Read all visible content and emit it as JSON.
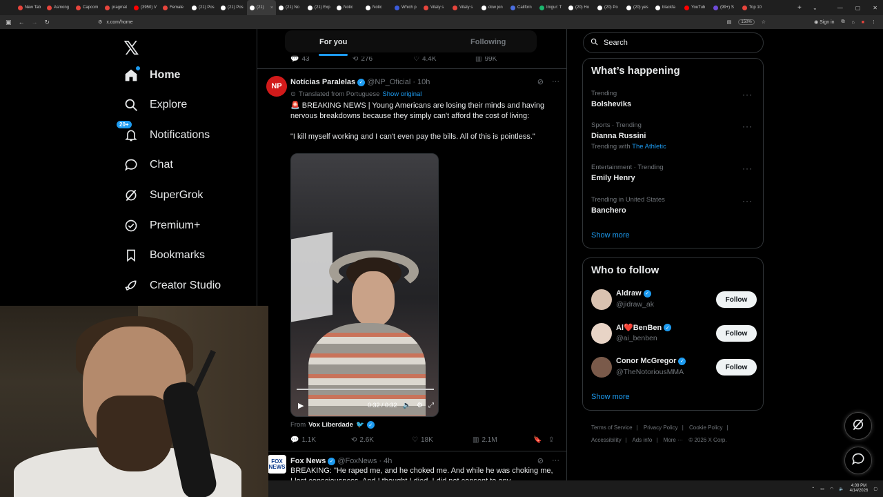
{
  "browser": {
    "tabs": [
      {
        "label": "New Tab",
        "color": "#e8453c"
      },
      {
        "label": "Asmong",
        "color": "#e8453c"
      },
      {
        "label": "Capcom",
        "color": "#e8453c"
      },
      {
        "label": "pragmat",
        "color": "#e8453c"
      },
      {
        "label": "(3950) V",
        "color": "#ff0000"
      },
      {
        "label": "Female",
        "color": "#e8453c"
      },
      {
        "label": "(21) Pos",
        "color": "#ffffff"
      },
      {
        "label": "(21) Pos",
        "color": "#ffffff"
      },
      {
        "label": "(21)",
        "color": "#ffffff",
        "active": true
      },
      {
        "label": "(21) No",
        "color": "#ffffff"
      },
      {
        "label": "(21) Exp",
        "color": "#ffffff"
      },
      {
        "label": "Notic",
        "color": "#ffffff"
      },
      {
        "label": "Notic",
        "color": "#ffffff"
      },
      {
        "label": "Which p",
        "color": "#3b5bdb"
      },
      {
        "label": "Vitaly s",
        "color": "#e8453c"
      },
      {
        "label": "Vitaly s",
        "color": "#e8453c"
      },
      {
        "label": "dow jon",
        "color": "#ffffff"
      },
      {
        "label": "Californ",
        "color": "#4a6ee0"
      },
      {
        "label": "Imgur: T",
        "color": "#1bb76e"
      },
      {
        "label": "(20) Ho",
        "color": "#ffffff"
      },
      {
        "label": "(20) Po",
        "color": "#ffffff"
      },
      {
        "label": "(20) yes",
        "color": "#ffffff"
      },
      {
        "label": "blackfa",
        "color": "#ffffff"
      },
      {
        "label": "YouTub",
        "color": "#ff0000"
      },
      {
        "label": "(99+) S",
        "color": "#6e4bd8"
      },
      {
        "label": "Top 10",
        "color": "#e8453c"
      }
    ],
    "url": "x.com/home",
    "zoom": "150%",
    "signin": "Sign in"
  },
  "nav": {
    "items": [
      {
        "label": "Home",
        "icon": "home-icon"
      },
      {
        "label": "Explore",
        "icon": "search-icon"
      },
      {
        "label": "Notifications",
        "icon": "bell-icon",
        "badge": "20+"
      },
      {
        "label": "Chat",
        "icon": "chat-icon"
      },
      {
        "label": "SuperGrok",
        "icon": "grok-icon"
      },
      {
        "label": "Premium+",
        "icon": "premium-icon"
      },
      {
        "label": "Bookmarks",
        "icon": "bookmark-icon"
      },
      {
        "label": "Creator Studio",
        "icon": "rocket-icon"
      }
    ]
  },
  "feed": {
    "tab_for_you": "For you",
    "tab_following": "Following",
    "prev_post_actions": {
      "replies": "43",
      "reposts": "276",
      "likes": "4.4K",
      "views": "99K"
    },
    "post1": {
      "avatar": "NP",
      "name": "Notícias Paralelas",
      "handle": "@NP_Oficial",
      "time": "· 10h",
      "translated": "Translated from Portuguese",
      "show_original": "Show original",
      "text1": "🚨 BREAKING NEWS | Young Americans are losing their minds and having nervous breakdowns because they simply can't afford the cost of living:",
      "text2": "\"I kill myself working and I can't even pay the bills. All of this is pointless.\"",
      "video_time": "0:32 / 0:32",
      "from_prefix": "From",
      "from_account": "Vox Liberdade",
      "replies": "1.1K",
      "reposts": "2.6K",
      "likes": "18K",
      "views": "2.1M"
    },
    "post2": {
      "avatar": "FOX NEWS",
      "name": "Fox News",
      "handle": "@FoxNews",
      "time": "· 4h",
      "text": "BREAKING: \"He raped me, and he choked me. And while he was choking me, I lost consciousness. And I thought I died. I did not consent to any"
    }
  },
  "sidebar": {
    "search_placeholder": "Search",
    "happening_title": "What’s happening",
    "trends": [
      {
        "meta": "Trending",
        "topic": "Bolsheviks",
        "extra_prefix": "",
        "extra_link": ""
      },
      {
        "meta": "Sports · Trending",
        "topic": "Dianna Russini",
        "extra_prefix": "Trending with",
        "extra_link": "The Athletic"
      },
      {
        "meta": "Entertainment · Trending",
        "topic": "Emily Henry",
        "extra_prefix": "",
        "extra_link": ""
      },
      {
        "meta": "Trending in United States",
        "topic": "Banchero",
        "extra_prefix": "",
        "extra_link": ""
      }
    ],
    "show_more": "Show more",
    "wtf_title": "Who to follow",
    "who_to_follow": [
      {
        "name": "Aldraw",
        "handle": "@jidraw_ak",
        "button": "Follow",
        "avatar_color": "#d9c2b0"
      },
      {
        "name": "Al❤️BenBen",
        "handle": "@ai_benben",
        "button": "Follow",
        "avatar_color": "#e8d4c6"
      },
      {
        "name": "Conor McGregor",
        "handle": "@TheNotoriousMMA",
        "button": "Follow",
        "avatar_color": "#7a5a4a"
      }
    ],
    "wtf_show_more": "Show more",
    "footer": [
      "Terms of Service",
      "|",
      "Privacy Policy",
      "|",
      "Cookie Policy",
      "|",
      "Accessibility",
      "|",
      "Ads info",
      "|",
      "More ···",
      "© 2026 X Corp."
    ]
  },
  "taskbar": {
    "time": "4:09 PM",
    "date": "4/14/2026"
  },
  "colors": {
    "accent": "#1d9bf0",
    "background": "#000000",
    "border": "#2f3336",
    "muted": "#71767b"
  }
}
